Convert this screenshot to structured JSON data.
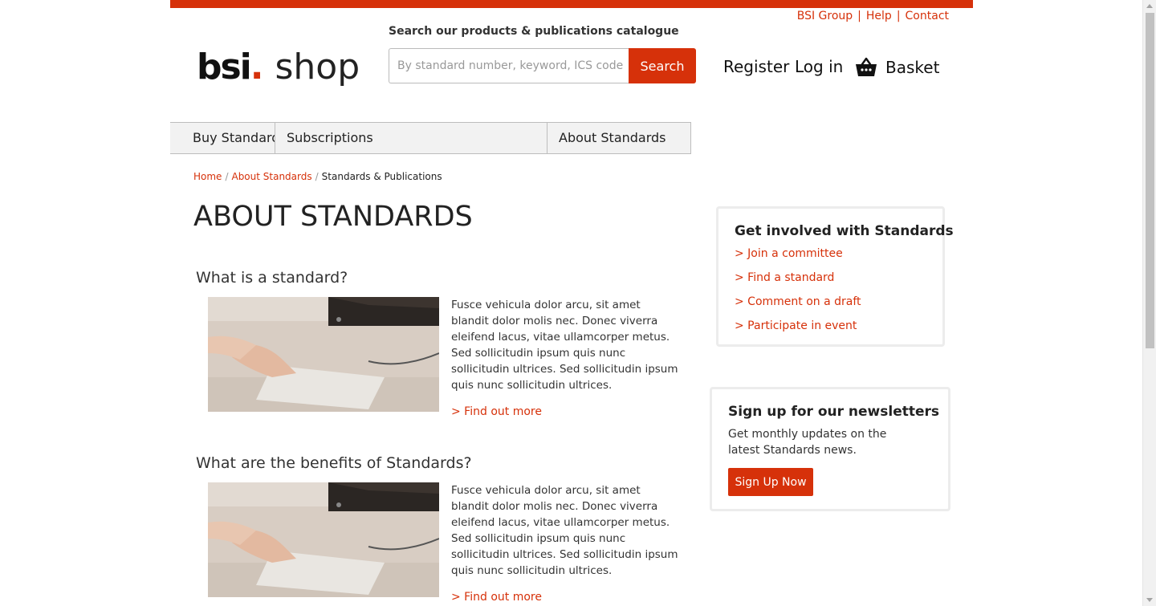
{
  "utility_links": [
    "BSI Group",
    "Help",
    "Contact"
  ],
  "logo": {
    "bsi": "bsi",
    "dot": ".",
    "shop": "shop"
  },
  "search": {
    "label": "Search our products & publications catalogue",
    "placeholder": "By standard number, keyword, ICS code, ISBN",
    "button": "Search"
  },
  "account": {
    "register": "Register",
    "login": "Log in",
    "basket": "Basket"
  },
  "nav": [
    "Buy Standards",
    "Subscriptions",
    "About Standards"
  ],
  "breadcrumb": {
    "home": "Home",
    "parent": "About Standards",
    "current": "Standards & Publications",
    "separator": "/"
  },
  "page_title": "ABOUT STANDARDS",
  "sections": [
    {
      "heading": "What is a standard?",
      "body": "Fusce vehicula dolor arcu, sit amet blandit dolor molis nec. Donec viverra eleifend lacus, vitae ullamcorper metus. Sed sollicitudin ipsum quis nunc sollicitudin ultrices. Sed sollicitudin ipsum quis nunc sollicitudin ultrices.",
      "link": "> Find out more"
    },
    {
      "heading": "What are the benefits of Standards?",
      "body": "Fusce vehicula dolor arcu, sit amet blandit dolor molis nec. Donec viverra eleifend lacus, vitae ullamcorper metus. Sed sollicitudin ipsum quis nunc sollicitudin ultrices. Sed sollicitudin ipsum quis nunc sollicitudin ultrices.",
      "link": "> Find out more"
    }
  ],
  "involved": {
    "title": "Get involved with Standards",
    "items": [
      "> Join a committee",
      "> Find a standard",
      "> Comment on a draft",
      "> Participate in event"
    ]
  },
  "newsletter": {
    "title": "Sign up for our newsletters",
    "description": "Get monthly updates on the latest Standards news.",
    "button": "Sign Up Now"
  },
  "colors": {
    "brand": "#d6310a",
    "nav_bg": "#f2f2f2",
    "card_border": "#ececec"
  },
  "icons": {
    "basket": "basket-icon"
  }
}
